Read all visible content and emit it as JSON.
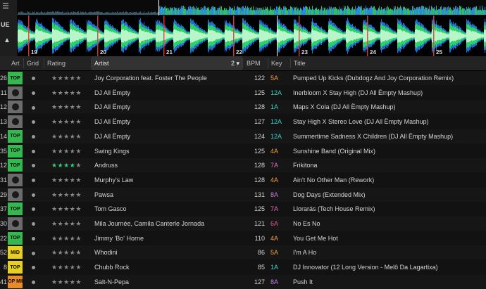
{
  "deck": {
    "strip_label": "UE",
    "beat_markers": [
      "19",
      "20",
      "21",
      "22",
      "23",
      "24",
      "25"
    ],
    "colors": {
      "wave_core": "#b8f5c8",
      "wave_mid": "#2fcf6a",
      "wave_outer": "#1f6fd0",
      "marker": "#e04040",
      "overview_fill": "#2a8ae0"
    }
  },
  "columns": {
    "art": "Art",
    "grid": "Grid",
    "rating": "Rating",
    "artist": "Artist",
    "artist_sort": "2",
    "bpm": "BPM",
    "key": "Key",
    "title": "Title"
  },
  "tracks": [
    {
      "num": "26",
      "art": "TOP",
      "art_color": "#35b84f",
      "rating": 0,
      "artist": "Joy Corporation feat. Foster The People",
      "bpm": "122",
      "key": "5A",
      "key_color": "#f0a040",
      "title": "Pumped Up Kicks (Dubdogz And Joy Corporation Remix)"
    },
    {
      "num": "11",
      "art": "disc",
      "art_color": "#6b6b6b",
      "rating": 0,
      "artist": "DJ All Ëmpty",
      "bpm": "125",
      "key": "12A",
      "key_color": "#38d6c8",
      "title": "Inerbloom X Stay High (DJ All Ëmpty Mashup)"
    },
    {
      "num": "12",
      "art": "disc",
      "art_color": "#6b6b6b",
      "rating": 0,
      "artist": "DJ All Ëmpty",
      "bpm": "128",
      "key": "1A",
      "key_color": "#38d6c8",
      "title": "Maps X Cola (DJ All Ëmpty Mashup)"
    },
    {
      "num": "13",
      "art": "disc",
      "art_color": "#6b6b6b",
      "rating": 0,
      "artist": "DJ All Ëmpty",
      "bpm": "127",
      "key": "12A",
      "key_color": "#38d6c8",
      "title": "Stay High X Stereo Love (DJ All Ëmpty Mashup)"
    },
    {
      "num": "14",
      "art": "TOP",
      "art_color": "#35b84f",
      "rating": 0,
      "artist": "DJ All Ëmpty",
      "bpm": "124",
      "key": "12A",
      "key_color": "#38d6c8",
      "title": "Summertime Sadness X Children (DJ All Ëmpty Mashup)"
    },
    {
      "num": "35",
      "art": "TOP",
      "art_color": "#35b84f",
      "rating": 0,
      "artist": "Swing Kings",
      "bpm": "125",
      "key": "4A",
      "key_color": "#f0a040",
      "title": "Sunshine Band (Original Mix)"
    },
    {
      "num": "12",
      "art": "TOP",
      "art_color": "#35b84f",
      "rating": 4,
      "artist": "Andruss",
      "bpm": "128",
      "key": "7A",
      "key_color": "#e070c0",
      "title": "Frikitona"
    },
    {
      "num": "31",
      "art": "disc",
      "art_color": "#6b6b6b",
      "rating": 0,
      "artist": "Murphy's Law",
      "bpm": "128",
      "key": "4A",
      "key_color": "#f0a040",
      "title": "Ain't No Other Man (Rework)"
    },
    {
      "num": "29",
      "art": "disc",
      "art_color": "#6b6b6b",
      "rating": 0,
      "artist": "Pawsa",
      "bpm": "131",
      "key": "8A",
      "key_color": "#c080e0",
      "title": "Dog Days (Extended Mix)"
    },
    {
      "num": "37",
      "art": "TOP",
      "art_color": "#35b84f",
      "rating": 0,
      "artist": "Tom Gasco",
      "bpm": "125",
      "key": "7A",
      "key_color": "#e070c0",
      "title": "Llorarás (Tech House Remix)"
    },
    {
      "num": "30",
      "art": "disc",
      "art_color": "#6b6b6b",
      "rating": 0,
      "artist": "Mila Journée, Camila Canterle Jornada",
      "bpm": "121",
      "key": "6A",
      "key_color": "#e05a8a",
      "title": "No Es No"
    },
    {
      "num": "22",
      "art": "TOP",
      "art_color": "#35b84f",
      "rating": 0,
      "artist": "Jimmy 'Bo' Horne",
      "bpm": "110",
      "key": "4A",
      "key_color": "#f0a040",
      "title": "You Get Me Hot"
    },
    {
      "num": "52",
      "art": "MID",
      "art_color": "#e8d020",
      "rating": 0,
      "artist": "Whodini",
      "bpm": "86",
      "key": "5A",
      "key_color": "#f0a040",
      "title": "I'm A Ho"
    },
    {
      "num": "8",
      "art": "TOP",
      "art_color": "#e8d020",
      "rating": 0,
      "artist": "Chubb Rock",
      "bpm": "85",
      "key": "1A",
      "key_color": "#38d6c8",
      "title": "DJ Innovator (12 Long Version - Melô Da Lagartixa)"
    },
    {
      "num": "41",
      "art": "TOP MID",
      "art_color": "#e8892a",
      "rating": 0,
      "artist": "Salt-N-Pepa",
      "bpm": "127",
      "key": "8A",
      "key_color": "#c080e0",
      "title": "Push It"
    }
  ]
}
